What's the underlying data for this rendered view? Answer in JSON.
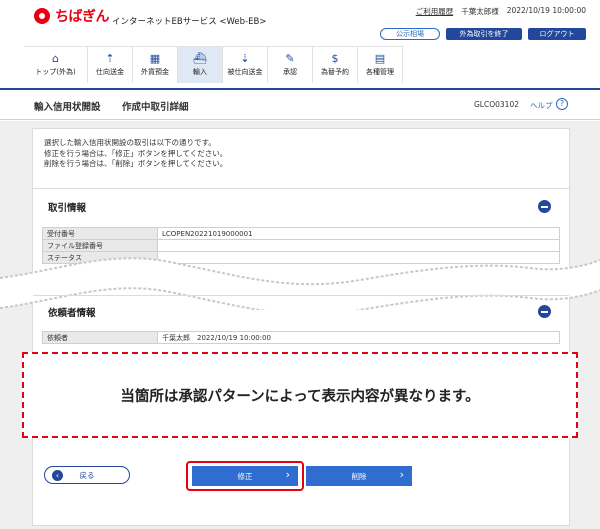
{
  "brand": {
    "logo_text": "ちばぎん",
    "service_name": "インターネットEBサービス <Web-EB>"
  },
  "top_links": {
    "usage_history": "ご利用履歴",
    "user_name": "千葉太郎様",
    "datetime": "2022/10/19 10:00:00"
  },
  "header_buttons": {
    "rates": "公示相場",
    "exit_fx": "外為取引を終了",
    "logout": "ログアウト"
  },
  "nav": [
    {
      "label": "トップ(外為)",
      "icon": "home-icon",
      "glyph": "⌂"
    },
    {
      "label": "仕向送金",
      "icon": "remittance-out-icon",
      "glyph": "⇡"
    },
    {
      "label": "外貨預金",
      "icon": "deposit-icon",
      "glyph": "▦"
    },
    {
      "label": "輸入",
      "icon": "import-icon",
      "glyph": "⛴"
    },
    {
      "label": "被仕向送金",
      "icon": "remittance-in-icon",
      "glyph": "⇣"
    },
    {
      "label": "承認",
      "icon": "approve-icon",
      "glyph": "✎"
    },
    {
      "label": "為替予約",
      "icon": "fx-contract-icon",
      "glyph": "$"
    },
    {
      "label": "各種管理",
      "icon": "management-icon",
      "glyph": "▤"
    }
  ],
  "page": {
    "title": "輸入信用状開設",
    "subtitle": "作成中取引詳細",
    "screen_id": "GLCO03102",
    "help": "ヘルプ",
    "help_icon": "?"
  },
  "intro": [
    "選択した輸入信用状開設の取引は以下の通りです。",
    "修正を行う場合は、「修正」ボタンを押してください。",
    "削除を行う場合は、「削除」ボタンを押してください。"
  ],
  "section_trade": {
    "title": "取引情報",
    "rows": [
      {
        "label": "受付番号",
        "value": "LCOPEN20221019000001"
      },
      {
        "label": "ファイル登録番号",
        "value": ""
      },
      {
        "label": "ステータス",
        "value": ""
      }
    ]
  },
  "section_requester": {
    "title": "依頼者情報",
    "rows": [
      {
        "label": "依頼者",
        "value": "千葉太郎　2022/10/19 10:00:00"
      }
    ]
  },
  "notice": "当箇所は承認パターンによって表示内容が異なります。",
  "buttons": {
    "back": "戻る",
    "edit": "修正",
    "delete": "削除"
  },
  "colors": {
    "brand_red": "#e60012",
    "navy": "#23489b",
    "button_blue": "#2f6ed0"
  }
}
